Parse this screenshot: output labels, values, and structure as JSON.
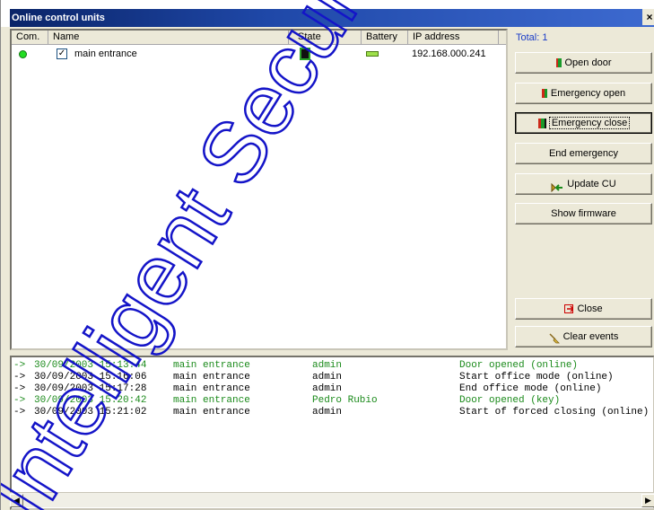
{
  "window": {
    "title": "Online control units",
    "close_glyph": "×"
  },
  "list": {
    "columns": [
      "Com.",
      "Name",
      "State",
      "Battery",
      "IP address"
    ],
    "rows": [
      {
        "name": "main entrance",
        "checked": "✓",
        "ip": "192.168.000.241"
      }
    ]
  },
  "panel": {
    "total": "Total: 1",
    "buttons": {
      "open_door": "Open door",
      "emergency_open": "Emergency open",
      "emergency_close": "Emergency close",
      "end_emergency": "End emergency",
      "update_cu": "Update CU",
      "show_firmware": "Show firmware",
      "close": "Close",
      "clear_events": "Clear events"
    }
  },
  "events": [
    {
      "arrow": "->",
      "datetime": "30/09/2003 15:13:44",
      "unit": "main entrance",
      "user": "admin",
      "event": "Door opened (online)",
      "color": "#1a8a1a"
    },
    {
      "arrow": "->",
      "datetime": "30/09/2003 15:16:06",
      "unit": "main entrance",
      "user": "admin",
      "event": "Start office mode (online)",
      "color": "#000000"
    },
    {
      "arrow": "->",
      "datetime": "30/09/2003 15:17:28",
      "unit": "main entrance",
      "user": "admin",
      "event": "End office mode (online)",
      "color": "#000000"
    },
    {
      "arrow": "->",
      "datetime": "30/09/2003 15:20:42",
      "unit": "main entrance",
      "user": "Pedro Rubio",
      "event": "Door opened (key)",
      "color": "#1a8a1a"
    },
    {
      "arrow": "->",
      "datetime": "30/09/2003 15:21:02",
      "unit": "main entrance",
      "user": "admin",
      "event": "Start of forced closing (online)",
      "color": "#000000"
    }
  ],
  "scroll": {
    "left_arrow": "◀",
    "right_arrow": "▶"
  },
  "watermark": "Intelligent Security"
}
